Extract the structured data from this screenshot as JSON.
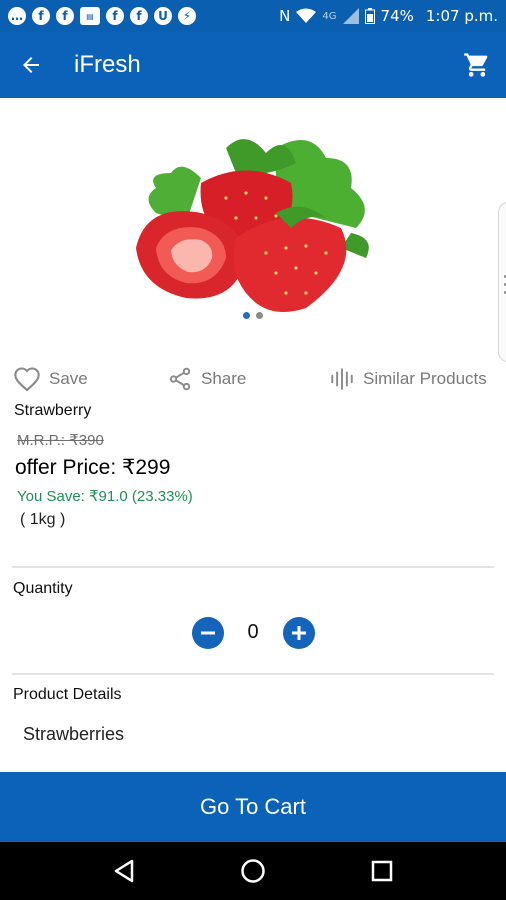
{
  "status_bar": {
    "network": "4G",
    "battery": "74%",
    "time": "1:07 p.m."
  },
  "app_bar": {
    "title": "iFresh",
    "back_icon": "arrow-left-icon",
    "cart_icon": "cart-icon"
  },
  "carousel": {
    "image_name": "strawberry-image",
    "slides": 2,
    "active_slide": 1
  },
  "actions": {
    "save_label": "Save",
    "share_label": "Share",
    "similar_label": "Similar Products"
  },
  "product": {
    "name": "Strawberry",
    "mrp": "M.R.P.: ₹390",
    "offer_price": "offer Price: ₹299",
    "you_save": "You Save: ₹91.0 (23.33%)",
    "weight": "( 1kg )"
  },
  "quantity": {
    "label": "Quantity",
    "value": "0"
  },
  "details": {
    "label": "Product Details",
    "text": "Strawberries"
  },
  "cart_bar": {
    "label": "Go To Cart"
  },
  "colors": {
    "primary": "#0b62b8",
    "save_green": "#1d8f5a",
    "action_gray": "#7a7a7a"
  }
}
